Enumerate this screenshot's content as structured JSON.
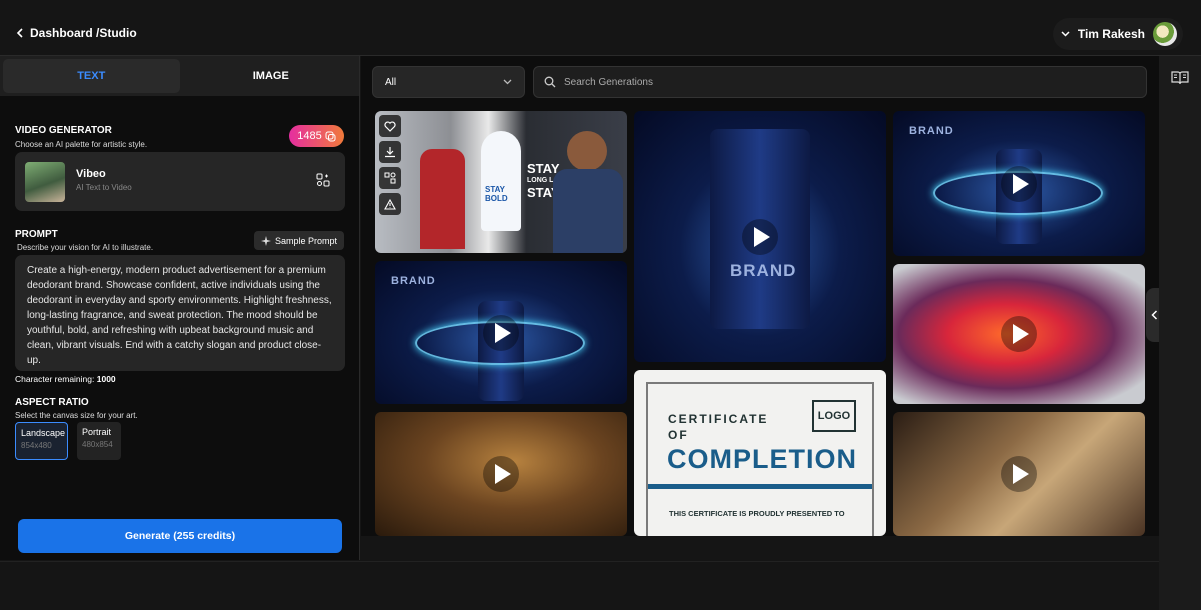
{
  "header": {
    "breadcrumb": "Dashboard /Studio",
    "user_name": "Tim Rakesh"
  },
  "tabs": [
    {
      "label": "TEXT",
      "active": true
    },
    {
      "label": "IMAGE",
      "active": false
    }
  ],
  "video_generator": {
    "title": "VIDEO GENERATOR",
    "subtitle": "Choose an AI palette for artistic style.",
    "credits": "1485",
    "model_name": "Vibeo",
    "model_sub": "AI Text to Video"
  },
  "prompt": {
    "title": "PROMPT",
    "subtitle": "Describe your vision for AI to illustrate.",
    "sample_button": "Sample Prompt",
    "text": "Create a high-energy, modern product advertisement for a premium deodorant brand. Showcase confident, active individuals using the deodorant in everyday and sporty environments. Highlight freshness, long-lasting fragrance, and sweat protection. The mood should be youthful, bold, and refreshing with upbeat background music and clean, vibrant visuals. End with a catchy slogan and product close-up.",
    "char_label": "Character remaining:",
    "char_count": "1000"
  },
  "aspect_ratio": {
    "title": "ASPECT RATIO",
    "subtitle": "Select the canvas size for your art.",
    "options": [
      {
        "name": "Landscape",
        "size": "854x480",
        "selected": true
      },
      {
        "name": "Portrait",
        "size": "480x854",
        "selected": false
      }
    ]
  },
  "generate_label": "Generate (255 credits)",
  "filter": {
    "value": "All"
  },
  "search": {
    "placeholder": "Search Generations"
  },
  "gallery": {
    "brand_word": "BRAND",
    "product_text": [
      "STAY",
      "BOLD",
      "STAY",
      "LONG LASTING",
      "STAY"
    ],
    "certificate": {
      "line1": "CERTIFICATE",
      "line2": "OF",
      "big": "COMPLETION",
      "logo": "LOGO",
      "small": "THIS CERTIFICATE IS PROUDLY PRESENTED TO"
    }
  },
  "colors": {
    "accent": "#1a73e8",
    "tab_active": "#3b8cff",
    "credits_gradient": [
      "#e52ea0",
      "#f07a3a"
    ]
  }
}
